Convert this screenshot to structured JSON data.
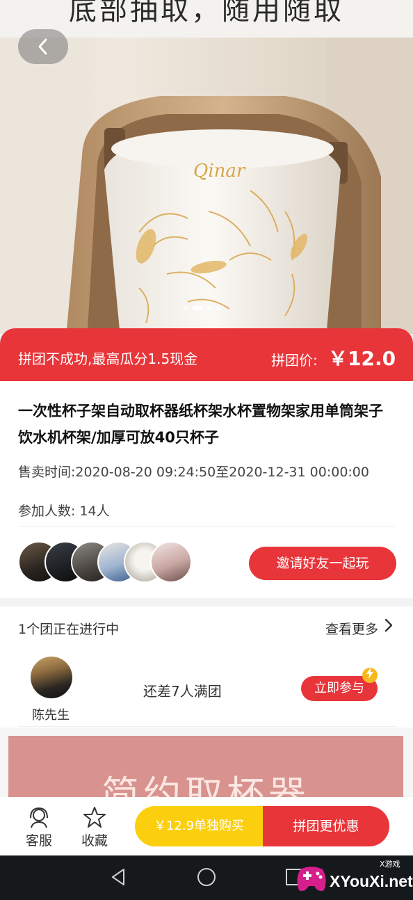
{
  "hero": {
    "top_banner_text": "底部抽取，随用随取",
    "back_icon": "chevron-left-icon",
    "carousel": {
      "count": 4,
      "active_index": 1
    }
  },
  "price_bar": {
    "promo_text": "拼团不成功,最高瓜分1.5现金",
    "price_label": "拼团价:",
    "price_value": "￥12.0"
  },
  "product": {
    "title": "一次性杯子架自动取杯器纸杯架水杯置物架家用单筒架子饮水机杯架/加厚可放40只杯子",
    "sale_time": "售卖时间:2020-08-20 09:24:50至2020-12-31 00:00:00",
    "participants": "参加人数: 14人",
    "invite_label": "邀请好友一起玩"
  },
  "group": {
    "title": "1个团正在进行中",
    "more_label": "查看更多",
    "more_icon": "chevron-right-icon",
    "leader_name": "陈先生",
    "status": "还差7人满团",
    "join_label": "立即参与",
    "join_badge_icon": "lightning-icon"
  },
  "detail": {
    "banner_text": "简约取杯器"
  },
  "bottom_bar": {
    "service_label": "客服",
    "service_icon": "headset-icon",
    "favorite_label": "收藏",
    "favorite_icon": "star-icon",
    "buy_alone_label": "￥12.9单独购买",
    "buy_group_label": "拼团更优惠"
  },
  "watermark": {
    "cn": "X游戏",
    "site": "XYouXi.net"
  },
  "colors": {
    "accent_red": "#e8353a",
    "accent_yellow": "#fbcf0d",
    "nav_dark": "#15191c"
  }
}
